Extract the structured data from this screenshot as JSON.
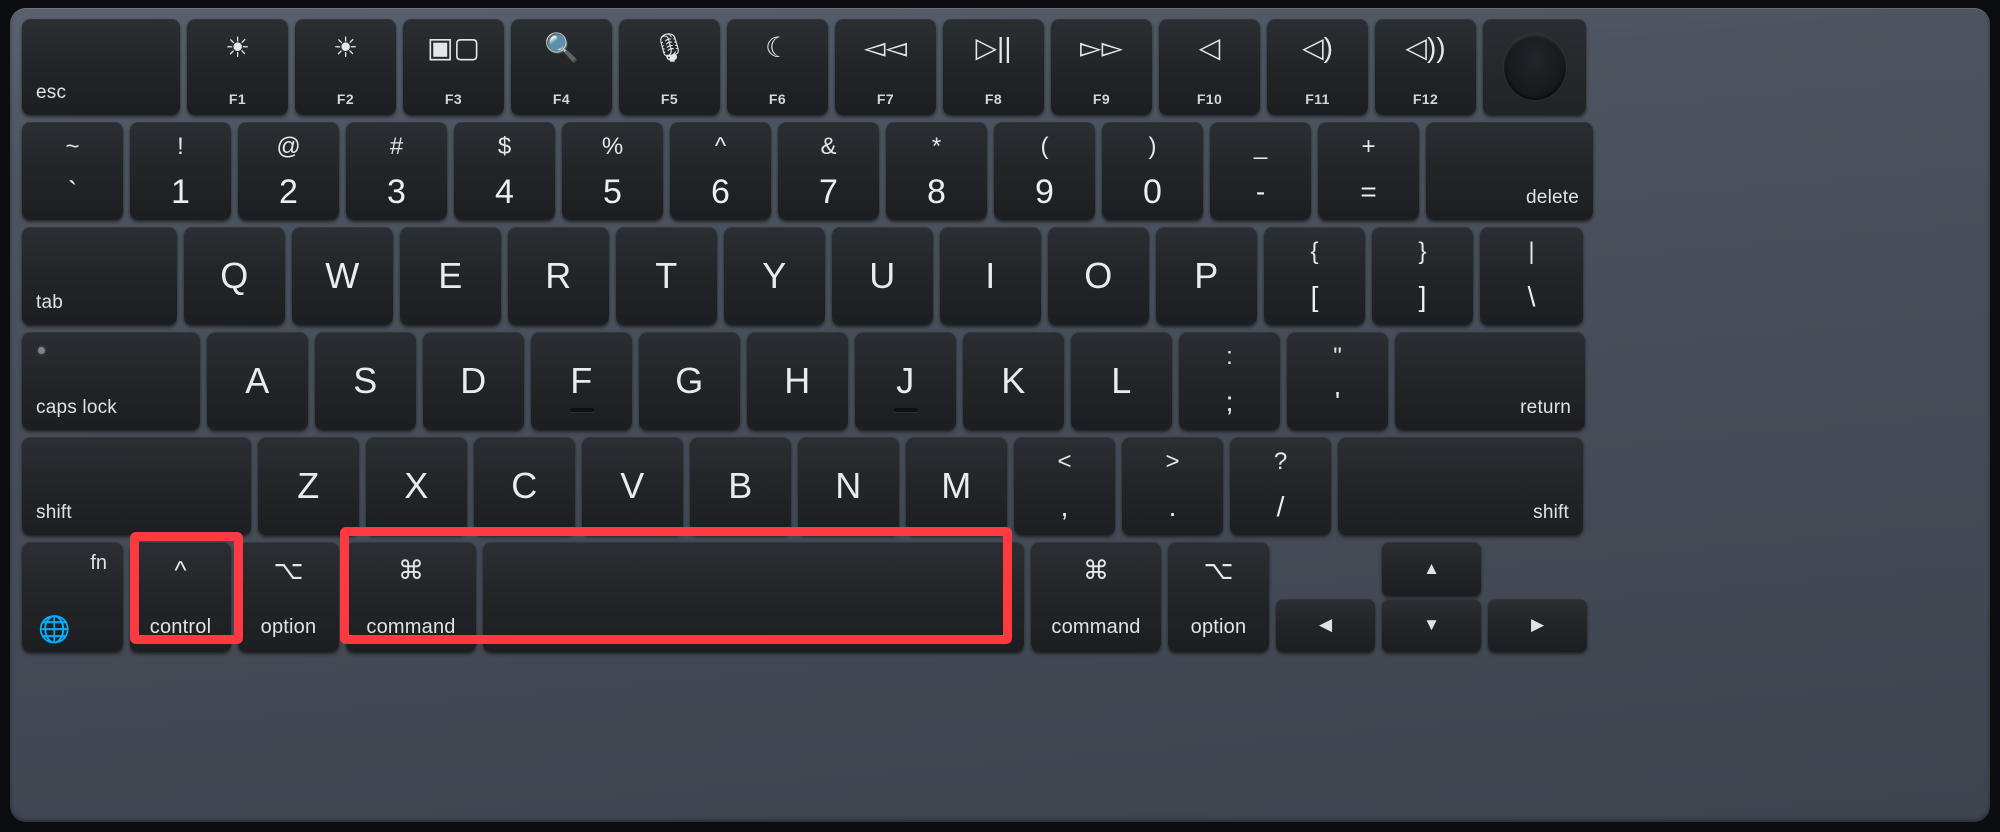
{
  "device": {
    "name": "macbook-keyboard",
    "layout": "US ANSI",
    "deck_color": "#4c545f",
    "key_color": "#26292d",
    "highlight_color": "#fd3a3f"
  },
  "highlights": [
    {
      "id": "control",
      "label": "control"
    },
    {
      "id": "command-space",
      "label": "command + space"
    }
  ],
  "rows": {
    "function_row": [
      {
        "name": "esc",
        "glyph": "",
        "sub": "",
        "label": "esc"
      },
      {
        "name": "f1",
        "glyph": "☀",
        "sub": "F1",
        "label": ""
      },
      {
        "name": "f2",
        "glyph": "☀",
        "sub": "F2",
        "label": ""
      },
      {
        "name": "f3",
        "glyph": "▣▢",
        "sub": "F3",
        "label": ""
      },
      {
        "name": "f4",
        "glyph": "🔍",
        "sub": "F4",
        "label": ""
      },
      {
        "name": "f5",
        "glyph": "🎙",
        "sub": "F5",
        "label": ""
      },
      {
        "name": "f6",
        "glyph": "☾",
        "sub": "F6",
        "label": ""
      },
      {
        "name": "f7",
        "glyph": "◅◅",
        "sub": "F7",
        "label": ""
      },
      {
        "name": "f8",
        "glyph": "▷||",
        "sub": "F8",
        "label": ""
      },
      {
        "name": "f9",
        "glyph": "▻▻",
        "sub": "F9",
        "label": ""
      },
      {
        "name": "f10",
        "glyph": "◁",
        "sub": "F10",
        "label": ""
      },
      {
        "name": "f11",
        "glyph": "◁)",
        "sub": "F11",
        "label": ""
      },
      {
        "name": "f12",
        "glyph": "◁))",
        "sub": "F12",
        "label": ""
      },
      {
        "name": "touch-id",
        "glyph": "",
        "sub": "",
        "label": ""
      }
    ],
    "number_row": [
      {
        "name": "grave",
        "top": "~",
        "bottom": "`"
      },
      {
        "name": "digit-1",
        "top": "!",
        "bottom": "1"
      },
      {
        "name": "digit-2",
        "top": "@",
        "bottom": "2"
      },
      {
        "name": "digit-3",
        "top": "#",
        "bottom": "3"
      },
      {
        "name": "digit-4",
        "top": "$",
        "bottom": "4"
      },
      {
        "name": "digit-5",
        "top": "%",
        "bottom": "5"
      },
      {
        "name": "digit-6",
        "top": "^",
        "bottom": "6"
      },
      {
        "name": "digit-7",
        "top": "&",
        "bottom": "7"
      },
      {
        "name": "digit-8",
        "top": "*",
        "bottom": "8"
      },
      {
        "name": "digit-9",
        "top": "(",
        "bottom": "9"
      },
      {
        "name": "digit-0",
        "top": ")",
        "bottom": "0"
      },
      {
        "name": "minus",
        "top": "_",
        "bottom": "-"
      },
      {
        "name": "equal",
        "top": "+",
        "bottom": "="
      },
      {
        "name": "delete",
        "top": "",
        "bottom": "",
        "label": "delete"
      }
    ],
    "top_letter_row": [
      {
        "name": "tab",
        "label": "tab"
      },
      {
        "name": "key-q",
        "label": "Q"
      },
      {
        "name": "key-w",
        "label": "W"
      },
      {
        "name": "key-e",
        "label": "E"
      },
      {
        "name": "key-r",
        "label": "R"
      },
      {
        "name": "key-t",
        "label": "T"
      },
      {
        "name": "key-y",
        "label": "Y"
      },
      {
        "name": "key-u",
        "label": "U"
      },
      {
        "name": "key-i",
        "label": "I"
      },
      {
        "name": "key-o",
        "label": "O"
      },
      {
        "name": "key-p",
        "label": "P"
      },
      {
        "name": "bracket-left",
        "top": "{",
        "bottom": "["
      },
      {
        "name": "bracket-right",
        "top": "}",
        "bottom": "]"
      },
      {
        "name": "backslash",
        "top": "|",
        "bottom": "\\"
      }
    ],
    "home_row": [
      {
        "name": "caps-lock",
        "label": "caps lock"
      },
      {
        "name": "key-a",
        "label": "A"
      },
      {
        "name": "key-s",
        "label": "S"
      },
      {
        "name": "key-d",
        "label": "D"
      },
      {
        "name": "key-f",
        "label": "F"
      },
      {
        "name": "key-g",
        "label": "G"
      },
      {
        "name": "key-h",
        "label": "H"
      },
      {
        "name": "key-j",
        "label": "J"
      },
      {
        "name": "key-k",
        "label": "K"
      },
      {
        "name": "key-l",
        "label": "L"
      },
      {
        "name": "semicolon",
        "top": ":",
        "bottom": ";"
      },
      {
        "name": "quote",
        "top": "\"",
        "bottom": "'"
      },
      {
        "name": "return",
        "label": "return"
      }
    ],
    "bottom_letter_row": [
      {
        "name": "shift-left",
        "label": "shift"
      },
      {
        "name": "key-z",
        "label": "Z"
      },
      {
        "name": "key-x",
        "label": "X"
      },
      {
        "name": "key-c",
        "label": "C"
      },
      {
        "name": "key-v",
        "label": "V"
      },
      {
        "name": "key-b",
        "label": "B"
      },
      {
        "name": "key-n",
        "label": "N"
      },
      {
        "name": "key-m",
        "label": "M"
      },
      {
        "name": "comma",
        "top": "<",
        "bottom": ","
      },
      {
        "name": "period",
        "top": ">",
        "bottom": "."
      },
      {
        "name": "slash",
        "top": "?",
        "bottom": "/"
      },
      {
        "name": "shift-right",
        "label": "shift"
      }
    ],
    "modifier_row": [
      {
        "name": "fn",
        "glyph": "🌐",
        "word": "fn"
      },
      {
        "name": "control-left",
        "glyph": "^",
        "word": "control"
      },
      {
        "name": "option-left",
        "glyph": "⌥",
        "word": "option"
      },
      {
        "name": "command-left",
        "glyph": "⌘",
        "word": "command"
      },
      {
        "name": "space",
        "glyph": "",
        "word": ""
      },
      {
        "name": "command-right",
        "glyph": "⌘",
        "word": "command"
      },
      {
        "name": "option-right",
        "glyph": "⌥",
        "word": "option"
      },
      {
        "name": "arrow-left",
        "glyph": "◀",
        "word": ""
      },
      {
        "name": "arrow-up",
        "glyph": "▲",
        "word": ""
      },
      {
        "name": "arrow-down",
        "glyph": "▼",
        "word": ""
      },
      {
        "name": "arrow-right",
        "glyph": "▶",
        "word": ""
      }
    ]
  }
}
